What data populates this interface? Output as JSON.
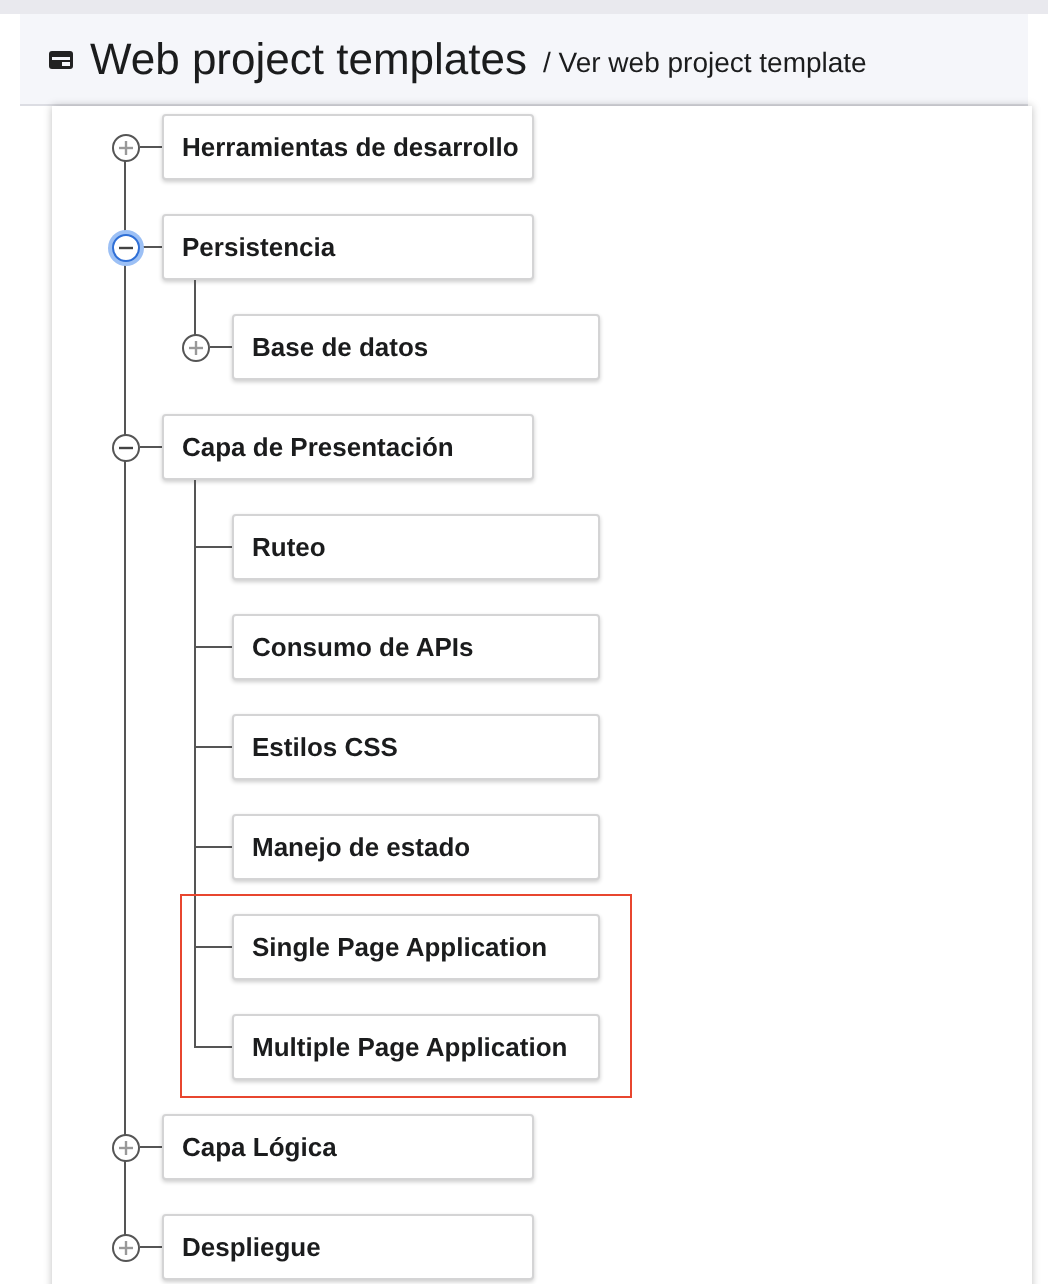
{
  "header": {
    "title": "Web project templates",
    "breadcrumb": "/ Ver web project template"
  },
  "tree": [
    {
      "label": "Herramientas de desarrollo",
      "kind": "expandable",
      "expanded": false,
      "focused": false,
      "highlighted": false
    },
    {
      "label": "Persistencia",
      "kind": "expandable",
      "expanded": true,
      "focused": true,
      "highlighted": false,
      "children": [
        {
          "label": "Base de datos",
          "kind": "expandable",
          "expanded": false,
          "focused": false,
          "highlighted": false
        }
      ]
    },
    {
      "label": "Capa de Presentación",
      "kind": "expandable",
      "expanded": true,
      "focused": false,
      "highlighted": false,
      "children": [
        {
          "label": "Ruteo",
          "kind": "leaf",
          "highlighted": false
        },
        {
          "label": "Consumo de APIs",
          "kind": "leaf",
          "highlighted": false
        },
        {
          "label": "Estilos CSS",
          "kind": "leaf",
          "highlighted": false
        },
        {
          "label": "Manejo de estado",
          "kind": "leaf",
          "highlighted": false
        },
        {
          "label": "Single Page Application",
          "kind": "leaf",
          "highlighted": true
        },
        {
          "label": "Multiple Page Application",
          "kind": "leaf",
          "highlighted": true
        }
      ]
    },
    {
      "label": "Capa Lógica",
      "kind": "expandable",
      "expanded": false,
      "focused": false,
      "highlighted": false
    },
    {
      "label": "Despliegue",
      "kind": "expandable",
      "expanded": false,
      "focused": false,
      "highlighted": false
    }
  ]
}
